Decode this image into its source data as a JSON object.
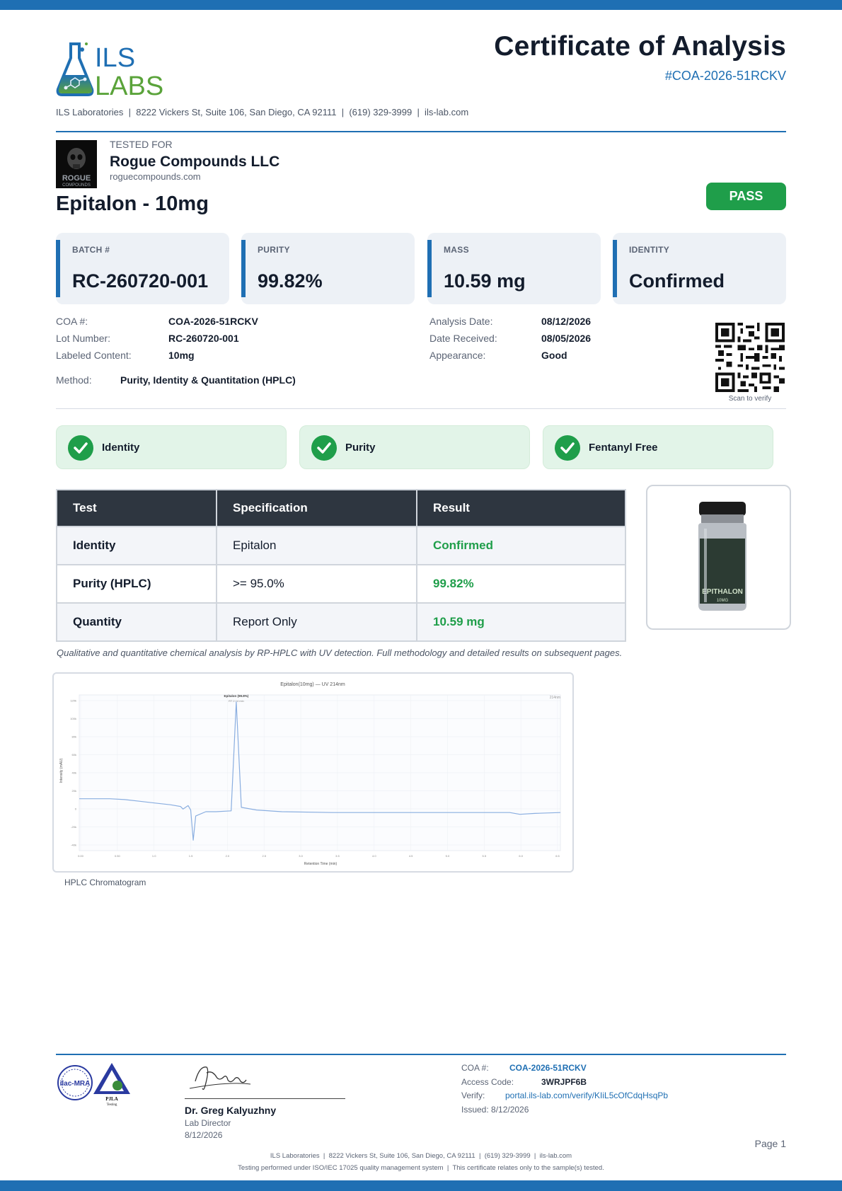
{
  "header": {
    "logo_text_top": "ILS",
    "logo_text_bottom": "LABS",
    "title": "Certificate of Analysis",
    "coa_number": "#COA-2026-51RCKV",
    "lab_line": "ILS Laboratories  |  8222 Vickers St, Suite 106, San Diego, CA 92111  |  (619) 329-3999  |  ils-lab.com"
  },
  "client": {
    "tested_for_label": "TESTED FOR",
    "name": "Rogue Compounds LLC",
    "website": "roguecompounds.com",
    "logo_text_1": "ROGUE",
    "logo_text_2": "COMPOUNDS"
  },
  "product": {
    "name": "Epitalon - 10mg",
    "status": "PASS"
  },
  "cards": [
    {
      "label": "BATCH #",
      "value": "RC-260720-001"
    },
    {
      "label": "PURITY",
      "value": "99.82%"
    },
    {
      "label": "MASS",
      "value": "10.59 mg"
    },
    {
      "label": "IDENTITY",
      "value": "Confirmed"
    }
  ],
  "details": {
    "coa_label": "COA #:",
    "coa_value": "COA-2026-51RCKV",
    "lot_label": "Lot Number:",
    "lot_value": "RC-260720-001",
    "content_label": "Labeled Content:",
    "content_value": "10mg",
    "method_label": "Method:",
    "method_value": "Purity, Identity & Quantitation (HPLC)",
    "analysis_label": "Analysis Date:",
    "analysis_value": "08/12/2026",
    "received_label": "Date Received:",
    "received_value": "08/05/2026",
    "appearance_label": "Appearance:",
    "appearance_value": "Good",
    "qr_caption": "Scan to verify"
  },
  "checks": [
    {
      "label": "Identity"
    },
    {
      "label": "Purity"
    },
    {
      "label": "Fentanyl Free"
    }
  ],
  "table": {
    "headers": [
      "Test",
      "Specification",
      "Result"
    ],
    "rows": [
      {
        "test": "Identity",
        "spec": "Epitalon",
        "result": "Confirmed"
      },
      {
        "test": "Purity (HPLC)",
        "spec": ">= 95.0%",
        "result": "99.82%"
      },
      {
        "test": "Quantity",
        "spec": "Report Only",
        "result": "10.59 mg"
      }
    ]
  },
  "vial": {
    "label_1": "EPITHALON",
    "label_2": "10MG"
  },
  "note": "Qualitative and quantitative chemical analysis by RP-HPLC with UV detection. Full methodology and detailed results on subsequent pages.",
  "chart_data": {
    "type": "line",
    "title": "Epitalon(10mg) — UV 214nm",
    "xlabel": "Retention Time (min)",
    "ylabel": "Intensity (mAU)",
    "xlim": [
      0.0,
      9.5
    ],
    "ylim": [
      -60,
      120
    ],
    "x_ticks": [
      "0.00",
      "0.50",
      "1.0",
      "1.5",
      "2.0",
      "2.5",
      "3.0",
      "3.5",
      "4.0",
      "4.5",
      "5.0",
      "5.5",
      "6.0",
      "6.5"
    ],
    "y_ticks": [
      "120k",
      "100k",
      "80k",
      "60k",
      "40k",
      "20k",
      "0",
      "-20k",
      "-40k"
    ],
    "legend": "214nm",
    "peak_label": "Epitalon (99.8%)",
    "peak_sublabel": "RT 2.14 min",
    "grid": true,
    "series": [
      {
        "color": "#8aaee0",
        "x": [
          0.0,
          0.3,
          0.6,
          0.9,
          1.2,
          1.5,
          1.8,
          2.0,
          2.05,
          2.15,
          2.2,
          2.25,
          2.3,
          2.5,
          2.7,
          3.0,
          3.1,
          3.2,
          3.5,
          4.0,
          5.0,
          6.0,
          7.0,
          8.0,
          8.5,
          8.7,
          9.0,
          9.5
        ],
        "y": [
          0,
          0,
          0,
          -1,
          -3,
          -5,
          -7,
          -9,
          -12,
          -8,
          -13,
          -48,
          -20,
          -15,
          -15,
          -14,
          112,
          -10,
          -13,
          -15,
          -16,
          -16,
          -16,
          -16,
          -16,
          -18,
          -17,
          -16
        ]
      }
    ]
  },
  "chrom_caption": "HPLC Chromatogram",
  "footer": {
    "seal_1": "ilac-MRA",
    "seal_2": "PJLA",
    "seal_2_sub": "Testing",
    "signer_name": "Dr. Greg Kalyuzhny",
    "signer_role": "Lab Director",
    "signer_date": "8/12/2026",
    "coa_label": "COA #:",
    "coa_value": "COA-2026-51RCKV",
    "access_label": "Access Code:",
    "access_value": "3WRJPF6B",
    "verify_label": "Verify:",
    "verify_value": "portal.ils-lab.com/verify/KIiL5cOfCdqHsqPb",
    "issued": "Issued: 8/12/2026",
    "page": "Page 1",
    "line1": "ILS Laboratories  |  8222 Vickers St, Suite 106, San Diego, CA 92111  |  (619) 329-3999  |  ils-lab.com",
    "line2": "Testing performed under ISO/IEC 17025 quality management system  |  This certificate relates only to the sample(s) tested."
  },
  "colors": {
    "brand_blue": "#1f6fb3",
    "pass_green": "#1f9e4a",
    "logo_green": "#5aa33a",
    "table_header": "#2e3640"
  }
}
